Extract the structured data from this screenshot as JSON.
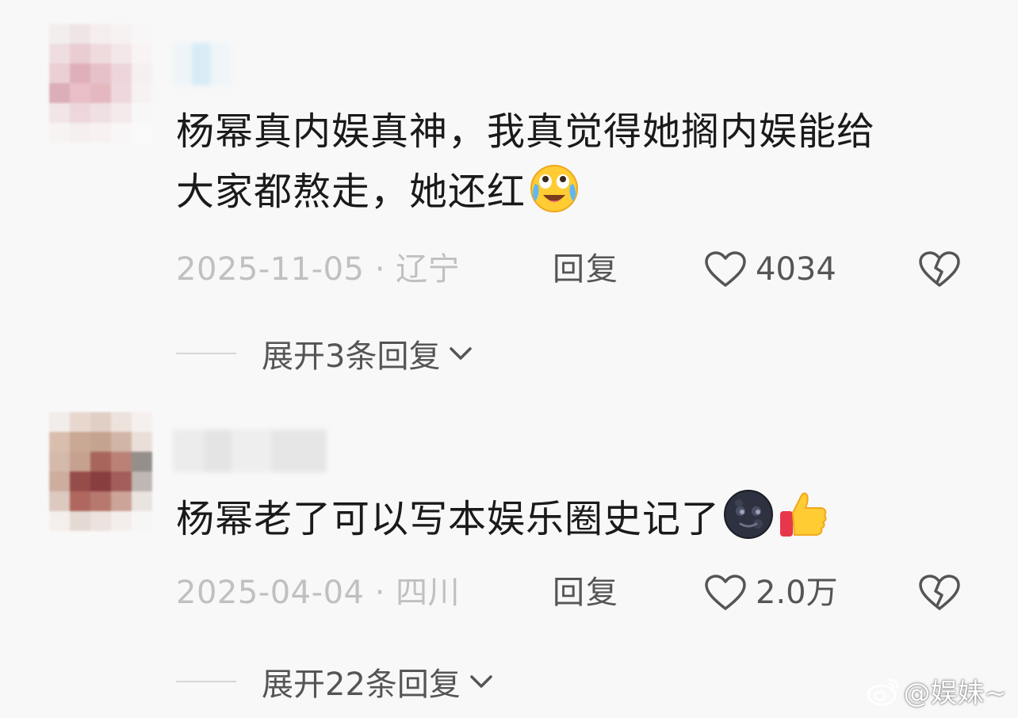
{
  "comments": [
    {
      "text_line1": "杨幂真内娱真神，我真觉得她搁内娱能给",
      "text_line2": "大家都熬走，她还红",
      "emoji": [
        "crying-laughing-emoji"
      ],
      "date": "2025-11-05",
      "location": "辽宁",
      "reply_label": "回复",
      "likes": "4034",
      "expand_label": "展开3条回复"
    },
    {
      "text_line1": "杨幂老了可以写本娱乐圈史记了",
      "emoji": [
        "new-moon-face-emoji",
        "thumbs-up-emoji"
      ],
      "date": "2025-04-04",
      "location": "四川",
      "reply_label": "回复",
      "likes": "2.0万",
      "expand_label": "展开22条回复"
    }
  ],
  "watermark": {
    "text": "@娱妹~",
    "icon": "weibo-icon"
  },
  "colors": {
    "background": "#f8f8f8",
    "text_primary": "#1a1a1a",
    "text_secondary": "#555555",
    "text_meta": "#c0c0c0"
  }
}
